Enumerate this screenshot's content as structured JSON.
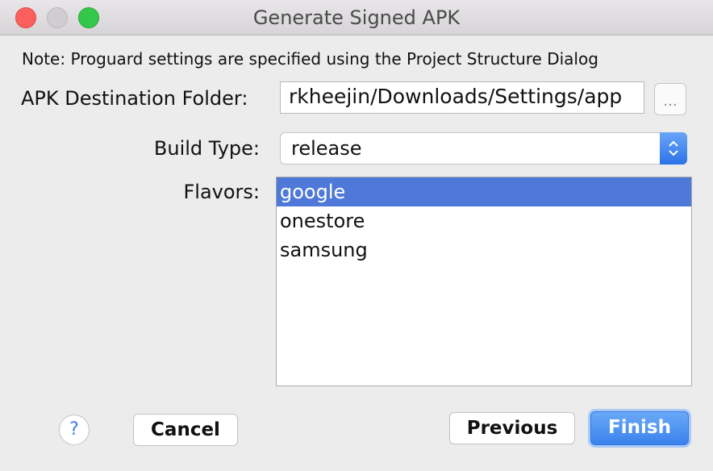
{
  "window": {
    "title": "Generate Signed APK"
  },
  "note": "Note: Proguard settings are specified using the Project Structure Dialog",
  "apk_destination": {
    "label": "APK Destination Folder:",
    "value": "rkheejin/Downloads/Settings/app",
    "browse_label": "..."
  },
  "build_type": {
    "label": "Build Type:",
    "selected": "release"
  },
  "flavors": {
    "label": "Flavors:",
    "items": [
      "google",
      "onestore",
      "samsung"
    ],
    "selected": "google"
  },
  "buttons": {
    "help": "?",
    "cancel": "Cancel",
    "previous": "Previous",
    "finish": "Finish"
  },
  "colors": {
    "selection": "#4f79d9",
    "accent": "#3a82ec",
    "close_light": "#fc605c",
    "max_light": "#34c84a"
  }
}
